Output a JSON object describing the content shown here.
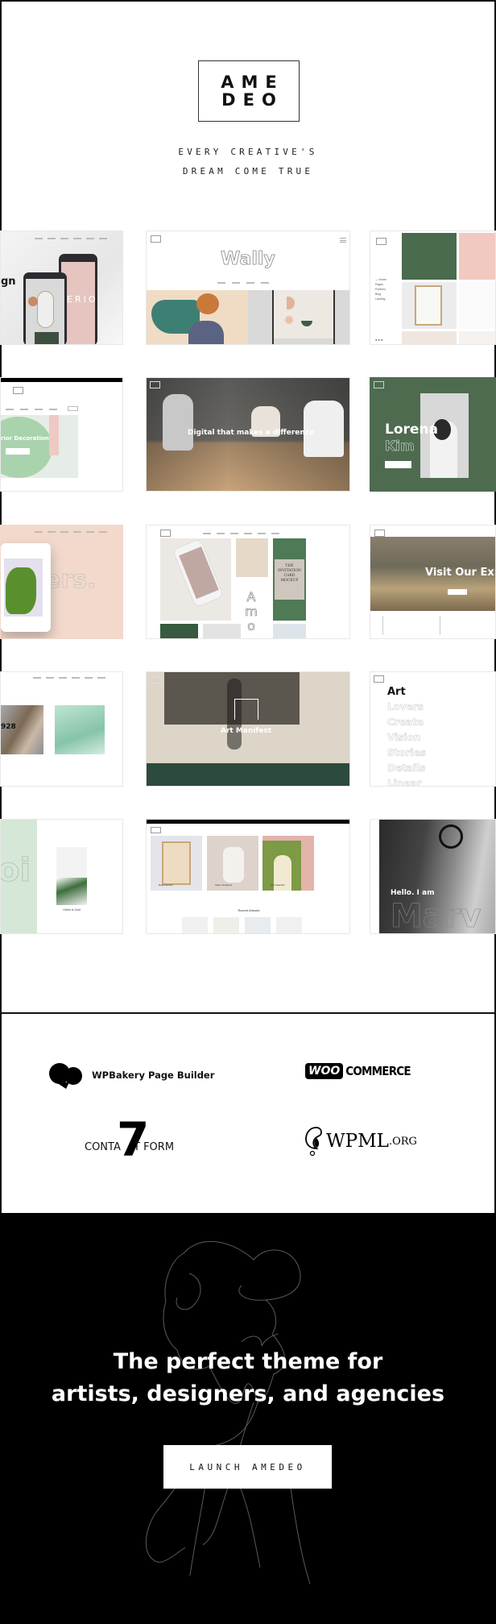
{
  "header": {
    "logo_line1": "AME",
    "logo_line2": "DEO",
    "tagline_line1": "EVERY CREATIVE'S",
    "tagline_line2": "DREAM COME TRUE"
  },
  "demos": [
    {
      "id": "interior-mobile",
      "title": "gn",
      "overlay": "ERIO"
    },
    {
      "id": "wally",
      "title": "Wally"
    },
    {
      "id": "illustrator",
      "menu": [
        "— Home",
        "Pages",
        "Portfolio",
        "Blog",
        "Landing"
      ]
    },
    {
      "id": "shop-interior",
      "title": "rior Decoration"
    },
    {
      "id": "agency",
      "title": "Digital that makes a difference"
    },
    {
      "id": "lorena",
      "title_line1": "Lorena",
      "title_line2": "Kim"
    },
    {
      "id": "illustrations",
      "title": "ers."
    },
    {
      "id": "studio-grid",
      "card_text": [
        "THE",
        "INVITATION",
        "CARD",
        "MOCKUP"
      ],
      "vertical": [
        "A",
        "m",
        "o"
      ]
    },
    {
      "id": "museum",
      "title": "Visit Our Ex"
    },
    {
      "id": "gallery",
      "title": "928"
    },
    {
      "id": "art-manifest",
      "title": "Art Manifest"
    },
    {
      "id": "art-lovers",
      "words": [
        "Art",
        "Lovers",
        "Create",
        "Vision",
        "Stories",
        "Details",
        "Linear"
      ]
    },
    {
      "id": "jewelry",
      "title": "oi",
      "product": "Green & Gold"
    },
    {
      "id": "art-shop",
      "products": [
        "Reproduction",
        "Stone Sculpture",
        "Art Collection"
      ],
      "section": "Recent Artwork"
    },
    {
      "id": "marv",
      "title_line1": "Hello. I am",
      "title_line2": "Marv"
    }
  ],
  "plugins": {
    "wpbakery": "WPBakery Page Builder",
    "woo_badge": "WOO",
    "woo_text": "COMMERCE",
    "cf7_text_left": "CONTA",
    "cf7_text_right": "T FORM",
    "cf7_number": "7",
    "wpml_main": "WPML",
    "wpml_suffix": ".ORG"
  },
  "cta": {
    "title_line1": "The perfect theme for",
    "title_line2": "artists, designers, and agencies",
    "button_label": "LAUNCH AMEDEO"
  },
  "colors": {
    "black": "#000000",
    "forest_green": "#4a6b4d",
    "blush": "#f2d9cc",
    "mint": "#d5e7d6"
  }
}
